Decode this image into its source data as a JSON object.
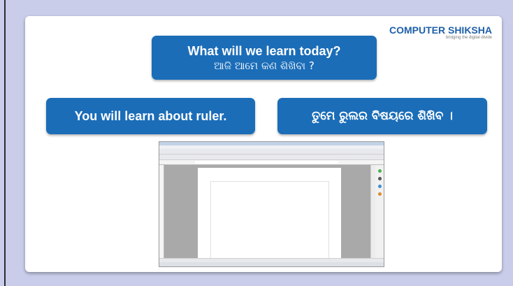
{
  "logo": {
    "name": "COMPUTER SHIKSHA",
    "tagline": "bridging the digital divide"
  },
  "question": {
    "english": "What will we learn today?",
    "odia": "ଆଜି ଆମେ କଣ ଶିଖିବା ?"
  },
  "answer": {
    "english": "You will learn about ruler.",
    "odia": "ତୁମେ ରୁଲର ବିଷୟରେ ଶିଖିବ ।"
  },
  "colors": {
    "box_blue": "#1b6db8",
    "background": "#c9cdea",
    "logo_blue": "#1f5fa8"
  },
  "illustration": {
    "description_icon": "word-processor-window-icon"
  }
}
